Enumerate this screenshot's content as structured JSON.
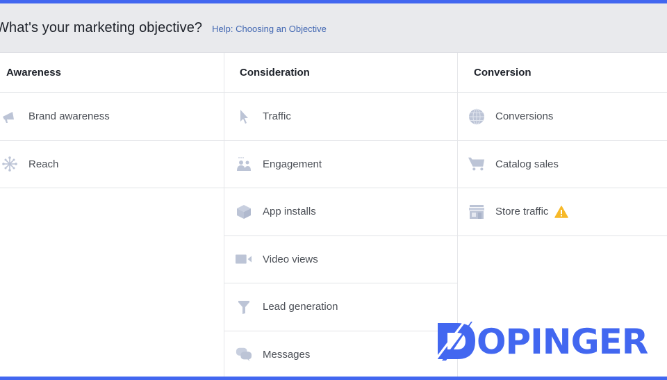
{
  "header": {
    "title": "What's your marketing objective?",
    "help_link": "Help: Choosing an Objective"
  },
  "columns": [
    {
      "title": "Awareness",
      "items": [
        {
          "label": "Brand awareness",
          "icon": "megaphone-icon"
        },
        {
          "label": "Reach",
          "icon": "reach-icon"
        }
      ]
    },
    {
      "title": "Consideration",
      "items": [
        {
          "label": "Traffic",
          "icon": "cursor-icon"
        },
        {
          "label": "Engagement",
          "icon": "people-icon"
        },
        {
          "label": "App installs",
          "icon": "box-icon"
        },
        {
          "label": "Video views",
          "icon": "video-camera-icon"
        },
        {
          "label": "Lead generation",
          "icon": "funnel-icon"
        },
        {
          "label": "Messages",
          "icon": "chat-bubbles-icon"
        }
      ]
    },
    {
      "title": "Conversion",
      "items": [
        {
          "label": "Conversions",
          "icon": "globe-icon"
        },
        {
          "label": "Catalog sales",
          "icon": "cart-icon"
        },
        {
          "label": "Store traffic",
          "icon": "store-icon",
          "badge": "warning-icon"
        }
      ]
    }
  ],
  "watermark": {
    "text": "OPINGER",
    "letter": "D"
  },
  "colors": {
    "frame": "#4267f0",
    "icon": "#bcc4d6",
    "link": "#4267b2",
    "warning": "#f7b928"
  }
}
